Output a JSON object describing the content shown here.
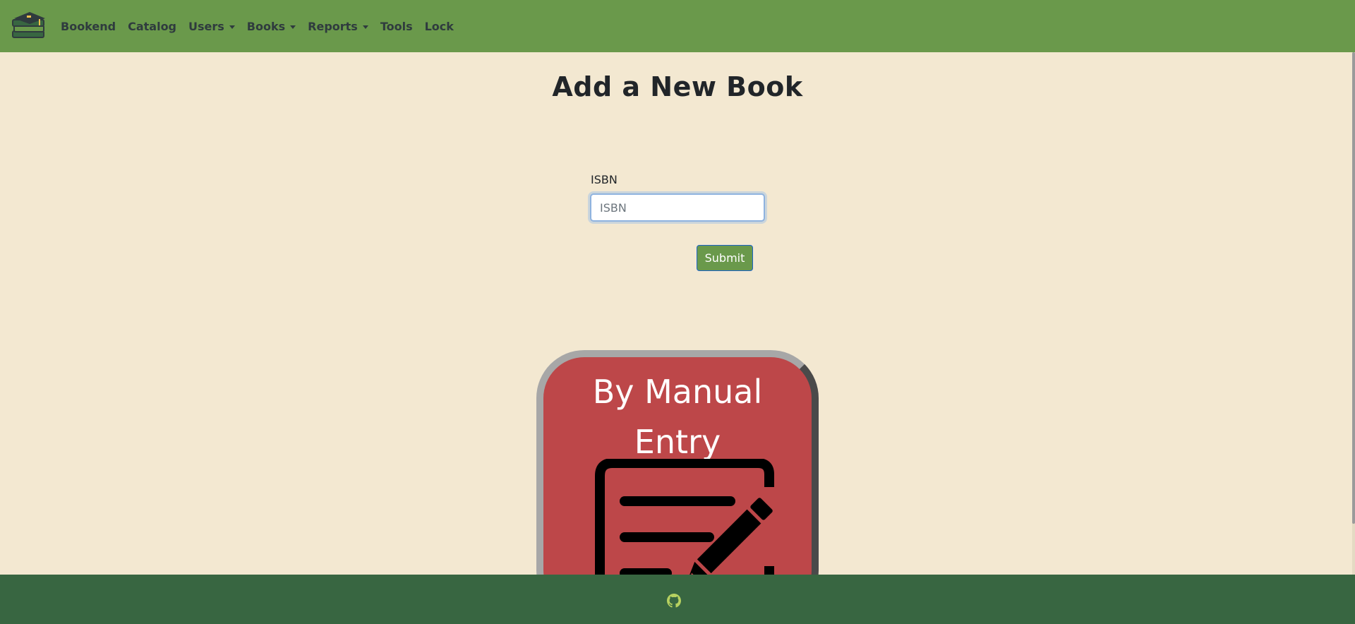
{
  "navbar": {
    "logo_icon": "book-stack-icon",
    "items": [
      {
        "label": "Bookend",
        "dropdown": false
      },
      {
        "label": "Catalog",
        "dropdown": false
      },
      {
        "label": "Users",
        "dropdown": true
      },
      {
        "label": "Books",
        "dropdown": true
      },
      {
        "label": "Reports",
        "dropdown": true
      },
      {
        "label": "Tools",
        "dropdown": false
      },
      {
        "label": "Lock",
        "dropdown": false
      }
    ]
  },
  "page": {
    "title": "Add a New Book"
  },
  "form": {
    "isbn_label": "ISBN",
    "isbn_value": "",
    "isbn_placeholder": "ISBN",
    "submit_label": "Submit"
  },
  "manual_entry": {
    "title_line1": "By Manual",
    "title_line2": "Entry",
    "icon": "document-edit-icon"
  },
  "footer": {
    "icon": "github-icon"
  },
  "colors": {
    "navbar": "#6a994b",
    "background": "#f3e8d1",
    "footer": "#386641",
    "card": "#bd4749",
    "submit_button": "#6a994b"
  }
}
